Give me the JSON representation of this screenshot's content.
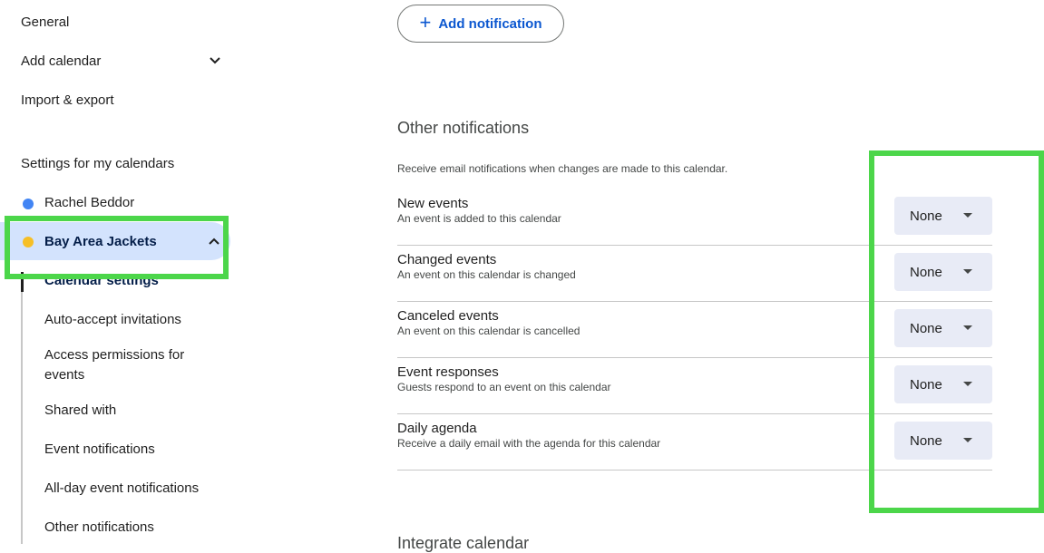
{
  "sidebar": {
    "general_label": "General",
    "add_calendar_label": "Add calendar",
    "import_export_label": "Import & export",
    "my_calendars_heading": "Settings for my calendars",
    "calendars": [
      {
        "name": "Rachel Beddor",
        "color": "#4285f4"
      },
      {
        "name": "Bay Area Jackets",
        "color": "#f6bf26"
      }
    ],
    "sub_items": [
      "Calendar settings",
      "Auto-accept invitations",
      "Access permissions for events",
      "Shared with",
      "Event notifications",
      "All-day event notifications",
      "Other notifications"
    ],
    "icons": {
      "add_calendar": "chevron-down-icon",
      "bay_area": "chevron-up-icon"
    }
  },
  "main": {
    "add_notification_label": "Add notification",
    "other_notifications_title": "Other notifications",
    "other_notifications_desc": "Receive email notifications when changes are made to this calendar.",
    "rows": [
      {
        "title": "New events",
        "subtitle": "An event is added to this calendar",
        "value": "None"
      },
      {
        "title": "Changed events",
        "subtitle": "An event on this calendar is changed",
        "value": "None"
      },
      {
        "title": "Canceled events",
        "subtitle": "An event on this calendar is cancelled",
        "value": "None"
      },
      {
        "title": "Event responses",
        "subtitle": "Guests respond to an event on this calendar",
        "value": "None"
      },
      {
        "title": "Daily agenda",
        "subtitle": "Receive a daily email with the agenda for this calendar",
        "value": "None"
      }
    ],
    "integrate_title": "Integrate calendar"
  },
  "colors": {
    "highlight": "#4cd64a",
    "selected_bg": "#d3e3fd",
    "accent": "#0b57d0"
  }
}
